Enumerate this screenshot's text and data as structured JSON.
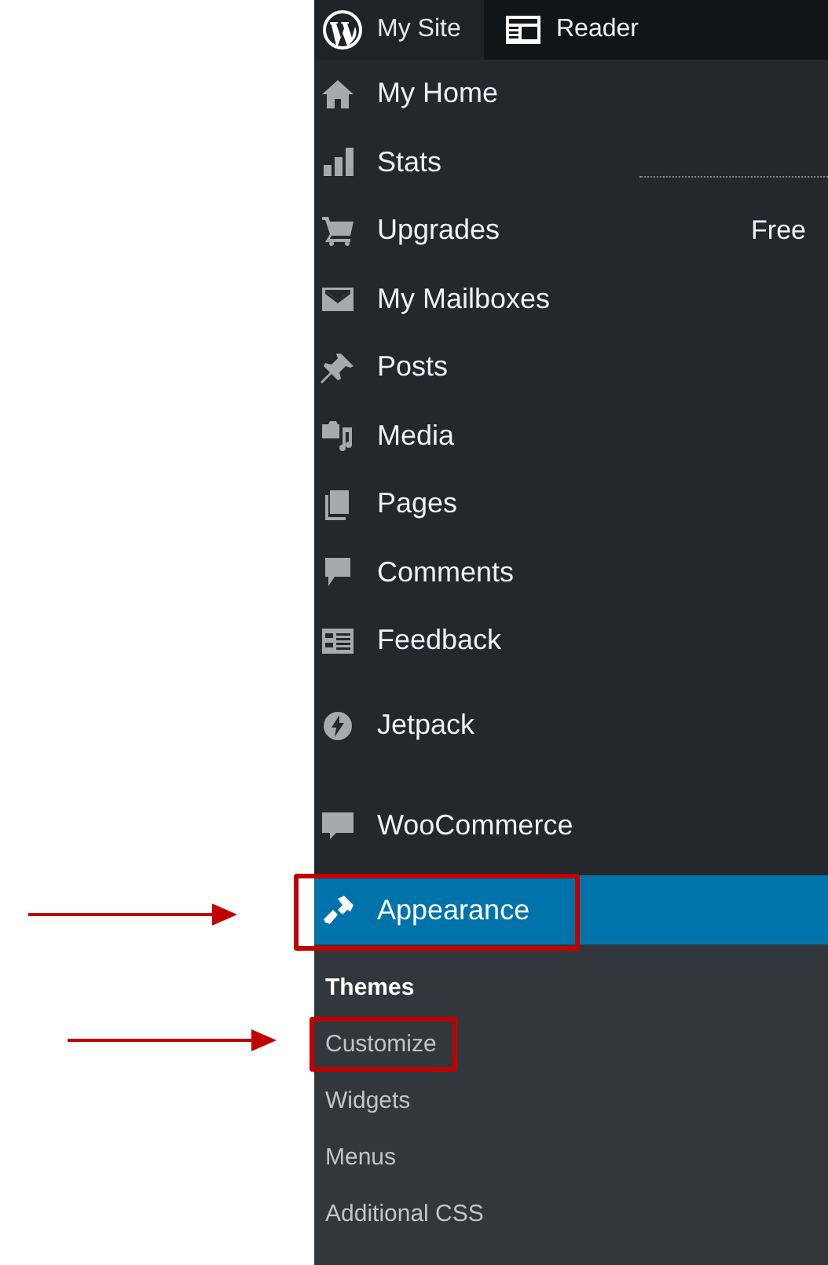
{
  "top_bar": {
    "tabs": [
      {
        "label": "My Site",
        "selected": true
      },
      {
        "label": "Reader",
        "selected": false
      }
    ]
  },
  "sidebar": {
    "items": [
      {
        "label": "My Home",
        "selected": false
      },
      {
        "label": "Stats",
        "selected": false
      },
      {
        "label": "Upgrades",
        "selected": false,
        "badge": "Free"
      },
      {
        "label": "My Mailboxes",
        "selected": false
      },
      {
        "label": "Posts",
        "selected": false
      },
      {
        "label": "Media",
        "selected": false
      },
      {
        "label": "Pages",
        "selected": false
      },
      {
        "label": "Comments",
        "selected": false
      },
      {
        "label": "Feedback",
        "selected": false
      },
      {
        "label": "Jetpack",
        "selected": false
      },
      {
        "label": "WooCommerce",
        "selected": false
      },
      {
        "label": "Appearance",
        "selected": true,
        "expanded": true,
        "children": [
          {
            "label": "Themes",
            "selected": true
          },
          {
            "label": "Customize",
            "selected": false
          },
          {
            "label": "Widgets",
            "selected": false
          },
          {
            "label": "Menus",
            "selected": false
          },
          {
            "label": "Additional CSS",
            "selected": false
          }
        ]
      }
    ]
  }
}
